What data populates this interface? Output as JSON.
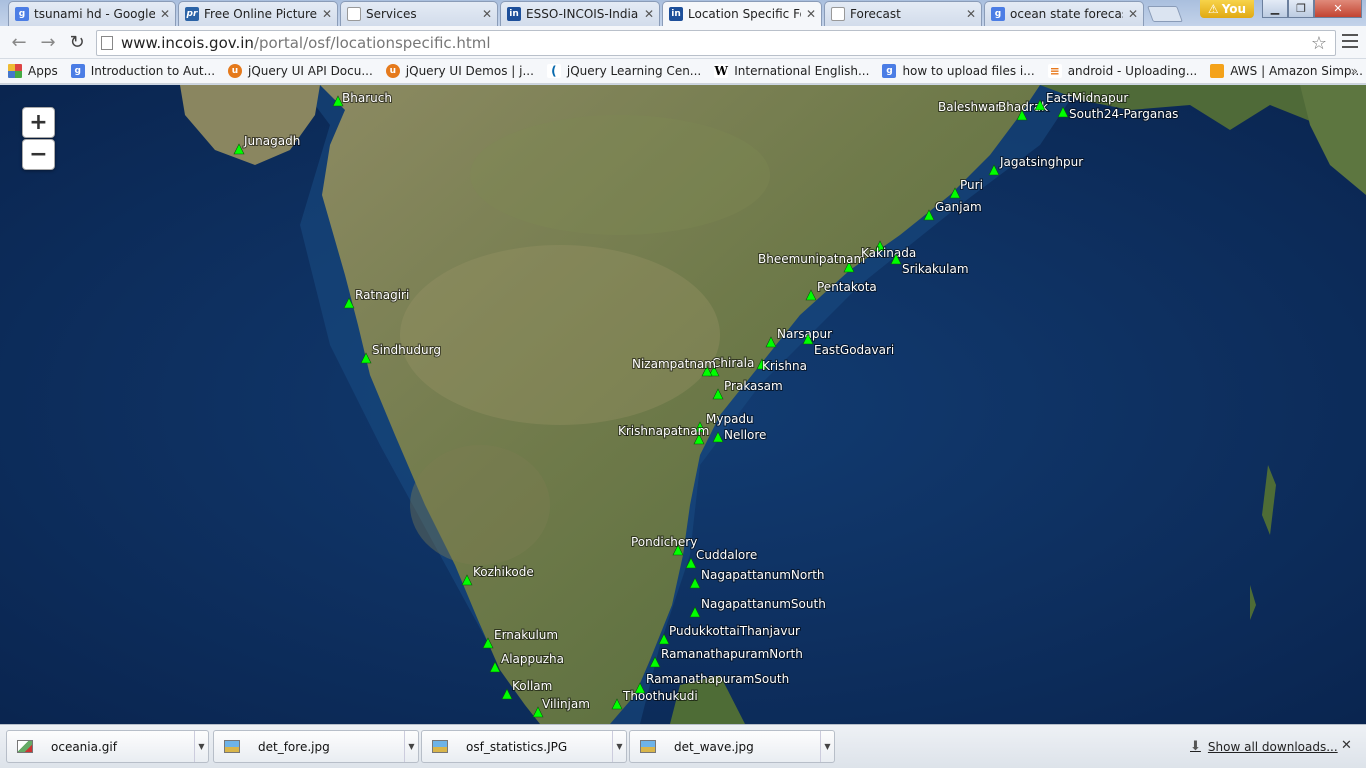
{
  "browser": {
    "tabs": [
      {
        "title": "tsunami hd - Google",
        "favicon": "google-icon",
        "active": false
      },
      {
        "title": "Free Online Picture I",
        "favicon": "picresize-icon",
        "active": false
      },
      {
        "title": "Services",
        "favicon": "page-icon",
        "active": false
      },
      {
        "title": "ESSO-INCOIS-Indian",
        "favicon": "incois-icon",
        "active": false
      },
      {
        "title": "Location Specific Fo",
        "favicon": "incois-icon",
        "active": true
      },
      {
        "title": "Forecast",
        "favicon": "page-icon",
        "active": false
      },
      {
        "title": "ocean state forecast",
        "favicon": "google-icon",
        "active": false
      }
    ],
    "user_label": "You",
    "url_host": "www.incois.gov.in",
    "url_path": "/portal/osf/locationspecific.html",
    "bookmarks": [
      {
        "label": "Apps",
        "icon": "apps-grid-icon"
      },
      {
        "label": "Introduction to Aut...",
        "icon": "google-icon"
      },
      {
        "label": "jQuery UI API Docu...",
        "icon": "jqueryui-icon"
      },
      {
        "label": "jQuery UI Demos | j...",
        "icon": "jqueryui-icon"
      },
      {
        "label": "jQuery Learning Cen...",
        "icon": "jquery-icon"
      },
      {
        "label": "International English...",
        "icon": "wikipedia-icon"
      },
      {
        "label": "how to upload files i...",
        "icon": "google-icon"
      },
      {
        "label": "android - Uploading...",
        "icon": "stackoverflow-icon"
      },
      {
        "label": "AWS | Amazon Simp...",
        "icon": "aws-icon"
      }
    ]
  },
  "map": {
    "zoom_in": "+",
    "zoom_out": "−",
    "marker_color": "#00ff00",
    "locations": [
      {
        "name": "Bharuch"
      },
      {
        "name": "Junagadh"
      },
      {
        "name": "Ratnagiri"
      },
      {
        "name": "Sindhudurg"
      },
      {
        "name": "Kozhikode"
      },
      {
        "name": "Ernakulum"
      },
      {
        "name": "Alappuzha"
      },
      {
        "name": "Kollam"
      },
      {
        "name": "Vilinjam"
      },
      {
        "name": "Thoothukudi"
      },
      {
        "name": "RamanathapuramSouth"
      },
      {
        "name": "RamanathapuramNorth"
      },
      {
        "name": "PudukkottaiThanjavur"
      },
      {
        "name": "NagapattanumSouth"
      },
      {
        "name": "NagapattanumNorth"
      },
      {
        "name": "Cuddalore"
      },
      {
        "name": "Pondichery"
      },
      {
        "name": "Nellore"
      },
      {
        "name": "Mypadu"
      },
      {
        "name": "Krishnapatnam"
      },
      {
        "name": "Prakasam"
      },
      {
        "name": "Chirala"
      },
      {
        "name": "Nizampatnam"
      },
      {
        "name": "Krishna"
      },
      {
        "name": "Narsapur"
      },
      {
        "name": "EastGodavari"
      },
      {
        "name": "Pentakota"
      },
      {
        "name": "Bheemunipatnam"
      },
      {
        "name": "Kakinada"
      },
      {
        "name": "Srikakulam"
      },
      {
        "name": "Ganjam"
      },
      {
        "name": "Puri"
      },
      {
        "name": "Jagatsinghpur"
      },
      {
        "name": "Baleshwar"
      },
      {
        "name": "Bhadrak"
      },
      {
        "name": "EastMidnapur"
      },
      {
        "name": "South24-Parganas"
      }
    ]
  },
  "downloads": {
    "items": [
      {
        "name": "oceania.gif"
      },
      {
        "name": "det_fore.jpg"
      },
      {
        "name": "osf_statistics.JPG"
      },
      {
        "name": "det_wave.jpg"
      }
    ],
    "show_all": "Show all downloads..."
  }
}
